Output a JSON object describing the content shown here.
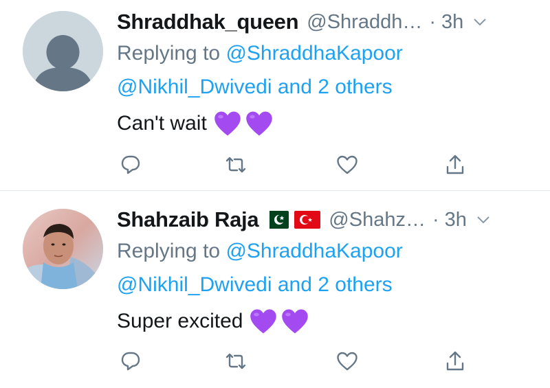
{
  "tweets": [
    {
      "name": "Shraddhak_queen",
      "handle": "@Shraddh…",
      "time": "· 3h",
      "replying_prefix": "Replying to ",
      "replying_to": "@ShraddhaKapoor",
      "others": "@Nikhil_Dwivedi and 2 others",
      "text": "Can't wait",
      "emoji": [
        "purple-heart",
        "purple-heart"
      ],
      "avatar": "default-profile-avatar"
    },
    {
      "name": "Shahzaib Raja",
      "flags": [
        "pakistan-flag",
        "turkey-flag"
      ],
      "handle": "@Shahz…",
      "time": "· 3h",
      "replying_prefix": "Replying to ",
      "replying_to": "@ShraddhaKapoor",
      "others": "@Nikhil_Dwivedi and 2 others",
      "text": "Super excited",
      "emoji": [
        "purple-heart",
        "purple-heart"
      ],
      "avatar": "user-photo-avatar"
    }
  ],
  "icons": {
    "reply": "reply-icon",
    "retweet": "retweet-icon",
    "like": "like-icon",
    "share": "share-icon",
    "more": "chevron-down-icon"
  },
  "colors": {
    "link": "#1da1f2",
    "muted": "#657786",
    "text": "#14171a",
    "heart": "#a34bf0",
    "divider": "#e1e8ed"
  }
}
